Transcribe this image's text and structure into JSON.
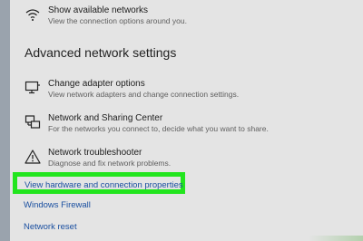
{
  "top_item": {
    "title": "Show available networks",
    "description": "View the connection options around you.",
    "icon": "wifi-signal-icon"
  },
  "advanced": {
    "heading": "Advanced network settings",
    "items": [
      {
        "title": "Change adapter options",
        "description": "View network adapters and change connection settings.",
        "icon": "monitor-adapter-icon"
      },
      {
        "title": "Network and Sharing Center",
        "description": "For the networks you connect to, decide what you want to share.",
        "icon": "sharing-center-icon"
      },
      {
        "title": "Network troubleshooter",
        "description": "Diagnose and fix network problems.",
        "icon": "warning-triangle-icon"
      }
    ]
  },
  "links": {
    "hardware_properties": "View hardware and connection properties",
    "firewall": "Windows Firewall",
    "reset": "Network reset"
  },
  "colors": {
    "highlight": "#22e51e",
    "link": "#1a4fa0",
    "panel_bg": "#e4e4e4"
  }
}
